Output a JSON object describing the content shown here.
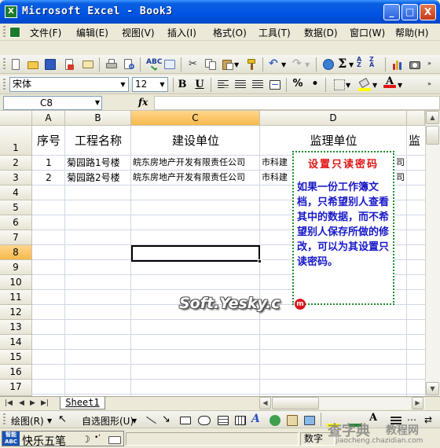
{
  "window": {
    "title": "Microsoft Excel - Book3",
    "minimize_glyph": "_",
    "maximize_glyph": "□",
    "close_glyph": "X"
  },
  "menubar": {
    "items": [
      {
        "label": "文件(F)"
      },
      {
        "label": "编辑(E)"
      },
      {
        "label": "视图(V)"
      },
      {
        "label": "插入(I)"
      },
      {
        "label": "格式(O)"
      },
      {
        "label": "工具(T)"
      },
      {
        "label": "数据(D)"
      },
      {
        "label": "窗口(W)"
      },
      {
        "label": "帮助(H)"
      }
    ]
  },
  "formatting": {
    "font_name": "宋体",
    "font_size": "12",
    "bold_glyph": "B",
    "underline_glyph": "U",
    "percent_glyph": "%",
    "comma_glyph": "•",
    "font_color": "#e01414",
    "fill_color": "#ffff00"
  },
  "formula_bar": {
    "name_box": "C8",
    "fx_label": "fx",
    "content": ""
  },
  "sheet": {
    "columns": [
      "A",
      "B",
      "C",
      "D"
    ],
    "selected_column": "C",
    "rows": [
      "1",
      "2",
      "3",
      "4",
      "5",
      "6",
      "7",
      "8",
      "9",
      "10",
      "11",
      "12",
      "13",
      "14",
      "15",
      "16",
      "17"
    ],
    "selected_row": "8",
    "header_row": {
      "a": "序号",
      "b": "工程名称",
      "c": "建设单位",
      "d": "监理单位",
      "e": "监"
    },
    "data_rows": [
      {
        "a": "1",
        "b": "菊园路1号楼",
        "c": "皖东房地产开发有限责任公司",
        "d": "市科建",
        "e": "司"
      },
      {
        "a": "2",
        "b": "菊园路2号楼",
        "c": "皖东房地产开发有限责任公司",
        "d": "市科建",
        "e": "司"
      }
    ],
    "selected_cell": "C8"
  },
  "comment": {
    "title": "设置只读密码",
    "body": "如果一份工作簿文档，只希望别人查看其中的数据，而不希望别人保存所做的修改，可以为其设置只读密码。"
  },
  "watermark": {
    "text": "Soft.Yesky.c",
    "suffix": "m"
  },
  "sheet_tabs": {
    "active": "Sheet1"
  },
  "drawing_toolbar": {
    "draw_label": "绘图(R)",
    "autoshape_label": "自选图形(U)"
  },
  "status_bar": {
    "ime_logo": "智能 ABC",
    "ime_name": "快乐五笔",
    "mode": "数字"
  },
  "corner_watermark": {
    "brand": "查字典",
    "sub": "教程网",
    "url": "jiaocheng.chazidian.com"
  }
}
